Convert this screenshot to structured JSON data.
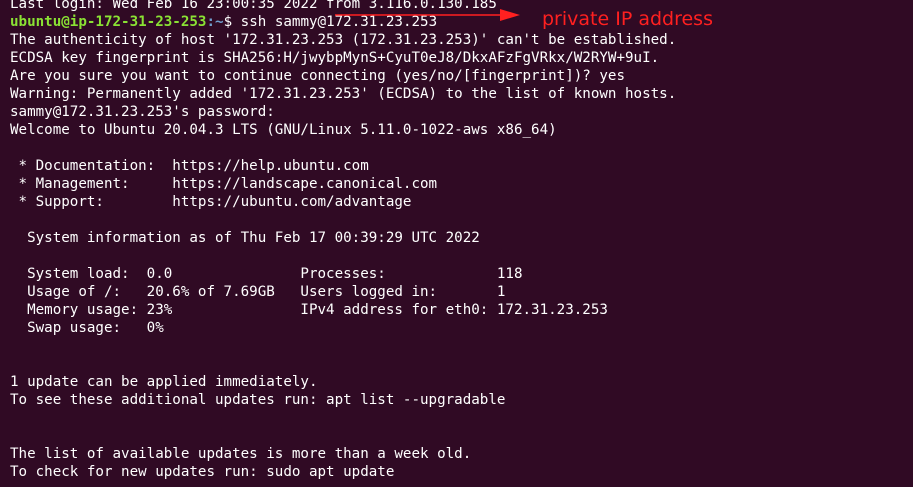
{
  "terminal": {
    "lines": [
      "Last login: Wed Feb 16 23:00:35 2022 from 3.116.0.130.185",
      "",
      "The authenticity of host '172.31.23.253 (172.31.23.253)' can't be established.",
      "ECDSA key fingerprint is SHA256:H/jwybpMynS+CyuT0eJ8/DkxAFzFgVRkx/W2RYW+9uI.",
      "Are you sure you want to continue connecting (yes/no/[fingerprint])? yes",
      "Warning: Permanently added '172.31.23.253' (ECDSA) to the list of known hosts.",
      "sammy@172.31.23.253's password:",
      "Welcome to Ubuntu 20.04.3 LTS (GNU/Linux 5.11.0-1022-aws x86_64)",
      "",
      " * Documentation:  https://help.ubuntu.com",
      " * Management:     https://landscape.canonical.com",
      " * Support:        https://ubuntu.com/advantage",
      "",
      "  System information as of Thu Feb 17 00:39:29 UTC 2022",
      "",
      "  System load:  0.0               Processes:             118",
      "  Usage of /:   20.6% of 7.69GB   Users logged in:       1",
      "  Memory usage: 23%               IPv4 address for eth0: 172.31.23.253",
      "  Swap usage:   0%",
      "",
      "",
      "1 update can be applied immediately.",
      "To see these additional updates run: apt list --upgradable",
      "",
      "",
      "The list of available updates is more than a week old.",
      "To check for new updates run: sudo apt update"
    ],
    "prompt": {
      "user_host": "ubuntu@ip-172-31-23-253",
      "path": ":~",
      "symbol": "$ ",
      "command": "ssh sammy@172.31.23.253"
    }
  },
  "annotation": {
    "label": "private IP address",
    "color": "#ff2020"
  },
  "colors": {
    "background": "#300a24",
    "text": "#ffffff",
    "prompt_user": "#8ae234",
    "prompt_path": "#729fcf"
  }
}
